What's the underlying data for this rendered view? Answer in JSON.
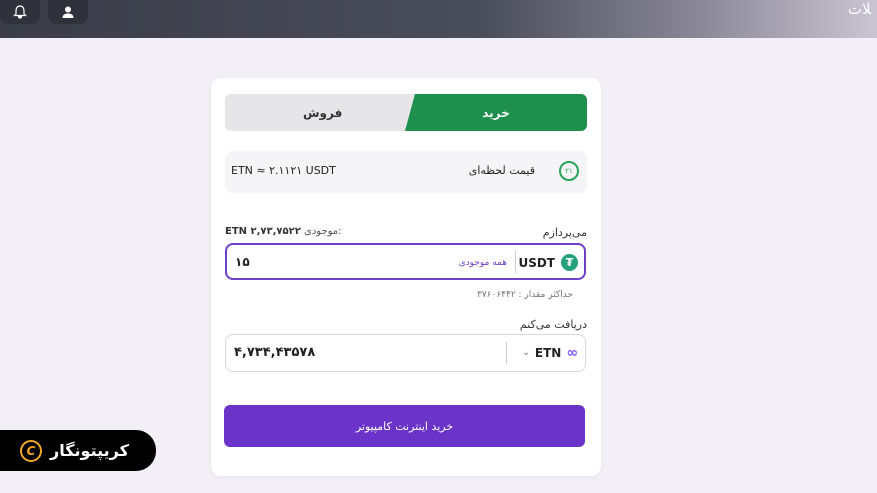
{
  "header": {
    "title": "ﻼت",
    "bell_icon": "bell-icon",
    "user_icon": "user-icon"
  },
  "tabs": {
    "buy_label": "خرید",
    "sell_label": "فروش"
  },
  "price": {
    "label": "قیمت لحظه‌ای",
    "value": "ETN ≈ ۲.۱۱۲۱ USDT",
    "timer": "۲۱"
  },
  "pay": {
    "label": "می‌پردازم",
    "balance_label": "موجودی:",
    "balance_value": "ETN ۲,۷۳,۷۵۲۲",
    "amount": "۱۵",
    "all_balance_label": "همه موجودی",
    "currency": "USDT",
    "max_note": "حداکثر مقدار : ۳۷۶۰۶۴۴۲"
  },
  "receive": {
    "label": "دریافت می‌کنم",
    "amount": "۴,۷۳۴,۴۳۵۷۸",
    "currency": "ETN"
  },
  "action": {
    "buy_button_label": "خرید اینترنت کامپیوتر"
  },
  "brand": {
    "name": "کریپتونگار"
  },
  "colors": {
    "accent": "#6a33c9",
    "buy_green": "#1f8f4d",
    "tether": "#26a17b"
  }
}
